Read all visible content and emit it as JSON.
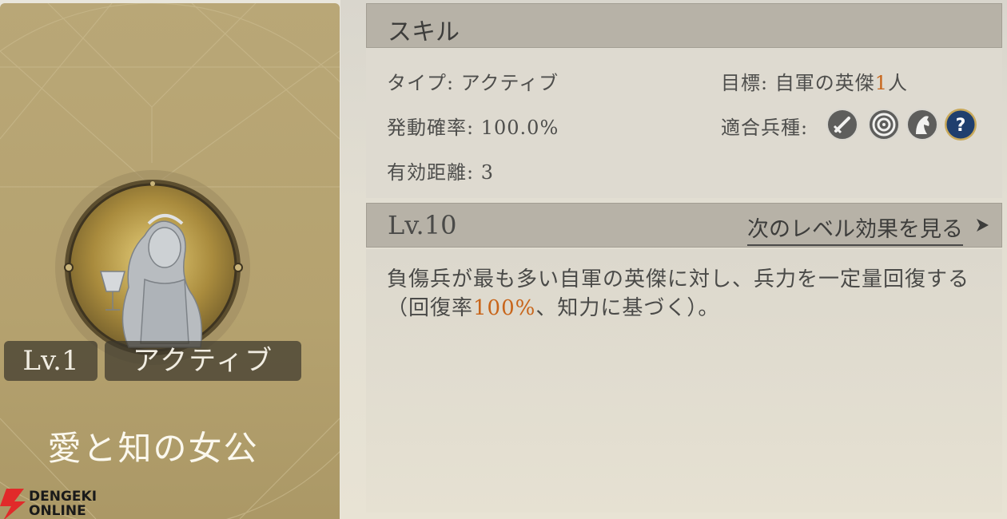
{
  "skill_card": {
    "level": "Lv.1",
    "type": "アクティブ",
    "name": "愛と知の女公",
    "portrait_icon": "lady-with-goblet-portrait"
  },
  "logo": {
    "line1": "DENGEKI",
    "line2": "ONLINE",
    "icon": "lightning-bolt-logo"
  },
  "skill_section": {
    "title": "スキル",
    "type_label": "タイプ:",
    "type_value": "アクティブ",
    "chance_label": "発動確率:",
    "chance_value": "100.0%",
    "range_label": "有効距離:",
    "range_value": "3",
    "target_label": "目標:",
    "target_prefix": "自軍の英傑",
    "target_count": "1",
    "target_suffix": "人",
    "units_label": "適合兵種:",
    "unit_icons": [
      "sword-icon",
      "target-icon",
      "horse-icon",
      "question-icon"
    ]
  },
  "level_section": {
    "level": "Lv.10",
    "next_link": "次のレベル効果を見る",
    "description_pre": "負傷兵が最も多い自軍の英傑に対し、兵力を一定量回復する（回復率",
    "description_value": "100%",
    "description_post": "、知力に基づく）。"
  },
  "colors": {
    "accent": "#c8651a",
    "card_gold": "#b5a26f",
    "header_gray": "#b7b2a7"
  }
}
